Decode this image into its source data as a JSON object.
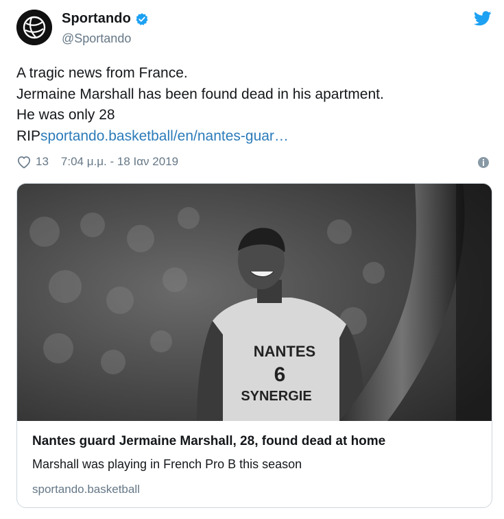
{
  "author": {
    "display_name": "Sportando",
    "handle": "@Sportando",
    "verified": true
  },
  "tweet": {
    "lines": [
      "A tragic news from France.",
      "Jermaine Marshall has been found dead in his apartment.",
      "He was only 28"
    ],
    "last_line_prefix": "RIP",
    "link_text": "sportando.basketball/en/nantes-guar…"
  },
  "meta": {
    "likes": "13",
    "timestamp": "7:04 μ.μ. - 18 Ιαν 2019"
  },
  "card": {
    "title": "Nantes guard Jermaine Marshall, 28, found dead at home",
    "description": "Marshall was playing in French Pro B this season",
    "domain": "sportando.basketball",
    "jersey": {
      "team": "NANTES",
      "number": "6",
      "sponsor": "SYNERGIE"
    }
  },
  "colors": {
    "link": "#2b7bb9",
    "twitter_blue": "#1da1f2",
    "secondary_text": "#657786"
  },
  "icons": {
    "avatar": "sportando-logo-icon",
    "verified": "verified-badge-icon",
    "brand": "twitter-bird-icon",
    "like": "heart-icon",
    "info": "info-icon"
  }
}
